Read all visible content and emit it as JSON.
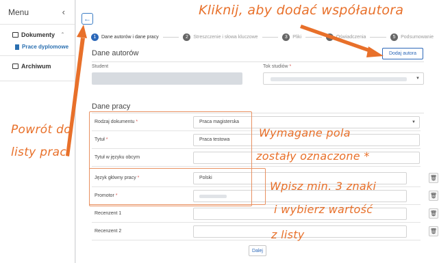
{
  "sidebar": {
    "menu_title": "Menu",
    "collapse_icon": "chevron-left-icon",
    "groups": [
      {
        "label": "Dokumenty",
        "icon": "document-stack-icon",
        "chevron": "chevron-up-icon",
        "sub": "Prace dyplomowe",
        "sub_icon": "file-icon"
      },
      {
        "label": "Archiwum",
        "icon": "archive-icon"
      }
    ]
  },
  "header": {
    "back_icon": "arrow-left-icon"
  },
  "stepper": {
    "steps": [
      {
        "num": "1",
        "label": "Dane autorów i dane pracy",
        "active": true
      },
      {
        "num": "2",
        "label": "Streszczenie i słowa kluczowe",
        "active": false
      },
      {
        "num": "3",
        "label": "Pliki",
        "active": false
      },
      {
        "num": "4",
        "label": "Oświadczenia",
        "active": false
      },
      {
        "num": "5",
        "label": "Podsumowanie",
        "active": false
      }
    ]
  },
  "authors": {
    "title": "Dane autorów",
    "student_label": "Student",
    "study_label": "Tok studiów",
    "req_mark": "*",
    "add_author_label": "Dodaj autora"
  },
  "work": {
    "title": "Dane pracy",
    "rows": [
      {
        "label": "Rodzaj dokumentu",
        "required": "*",
        "value": "Praca magisterska",
        "select": true
      },
      {
        "label": "Tytuł",
        "required": "*",
        "value": "Praca testowa"
      },
      {
        "label": "Tytuł w języku obcym",
        "required": "",
        "value": ""
      },
      {
        "label": "Język główny pracy",
        "required": "*",
        "value": "Polski"
      },
      {
        "label": "Promotor",
        "required": "*",
        "value": "",
        "blurred": true
      },
      {
        "label": "Recenzent 1",
        "required": "",
        "value": ""
      },
      {
        "label": "Recenzent 2",
        "required": "",
        "value": ""
      }
    ],
    "trash_icon": "trash-icon"
  },
  "footer": {
    "next_label": "Dalej"
  },
  "annotations": {
    "add_author": "Kliknij, aby dodać współautora",
    "back_line1": "Powrót do",
    "back_line2": "listy prac",
    "required_line1": "Wymagane pola",
    "required_line2": "zostały oznaczone *",
    "type_line1": "Wpisz min. 3 znaki",
    "type_line2": "i wybierz wartość",
    "type_line3": "z listy"
  },
  "colors": {
    "accent": "#2b67b8",
    "annotation": "#e8702a",
    "required": "#d9534f"
  }
}
